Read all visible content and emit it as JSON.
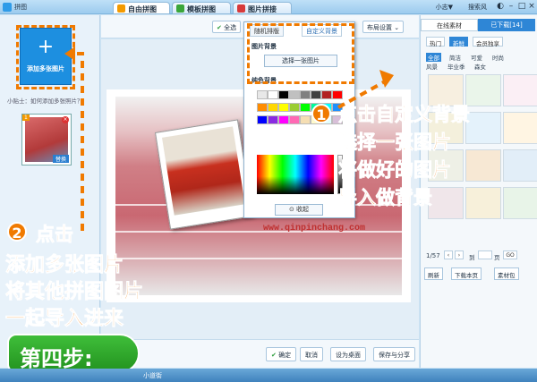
{
  "app": {
    "title": "拼图"
  },
  "tabs": [
    {
      "label": "自由拼图"
    },
    {
      "label": "模板拼图"
    },
    {
      "label": "图片拼接"
    }
  ],
  "header": {
    "user": "小志▼",
    "search": "搜索风"
  },
  "left": {
    "add_label": "添加多张图片",
    "tip": "小贴士：如何添加多张照片？",
    "thumb_num": "1",
    "thumb_replace": "替换"
  },
  "toolbar": {
    "left_btn": "全选",
    "right_btn": "布局设置"
  },
  "popup": {
    "tab_random": "随机排版",
    "tab_custom": "自定义背景",
    "bg_label": "图片背景",
    "choose": "选择一张图片",
    "solid_label": "纯色背景",
    "collapse": "收起",
    "colors": [
      "#e8e8e8",
      "#ffffff",
      "#000000",
      "#c0c0c0",
      "#808080",
      "#404040",
      "#b22222",
      "#ff0000",
      "#ff8c00",
      "#ffd700",
      "#ffff00",
      "#9acd32",
      "#00ff00",
      "#00fa9a",
      "#00ffff",
      "#1e90ff",
      "#0000ff",
      "#8a2be2",
      "#ff00ff",
      "#ff69b4",
      "#f5deb3",
      "#fffacd",
      "#e0ffff",
      "#d8bfd8"
    ]
  },
  "watermark": "www.qinpinchang.com",
  "bottom": {
    "ok": "确定",
    "cancel": "取消",
    "desktop": "设为桌面",
    "save": "保存与分享"
  },
  "right": {
    "tab_online": "在线素材",
    "tab_downloaded": "已下载[14]",
    "cats": [
      "热门",
      "新鲜",
      "会员独享"
    ],
    "subcats": [
      "全部",
      "简洁",
      "可爱",
      "时尚",
      "风景",
      "毕业季",
      "森女"
    ],
    "pager": "1/57",
    "goto_label": "到",
    "page_label": "页",
    "go": "GO",
    "refresh": "刷新",
    "download_page": "下载本页",
    "pack": "素材包"
  },
  "annotations": {
    "a1": [
      "点击自定义背景",
      "选择一张图片",
      "将做好的图片",
      "导入做背景"
    ],
    "badge1": "1",
    "a2": [
      "点击",
      "添加多张图片",
      "将其他拼图图片",
      "一起导入进来"
    ],
    "badge2": "2",
    "step": "第四步:"
  },
  "status": {
    "text": "小道街"
  }
}
